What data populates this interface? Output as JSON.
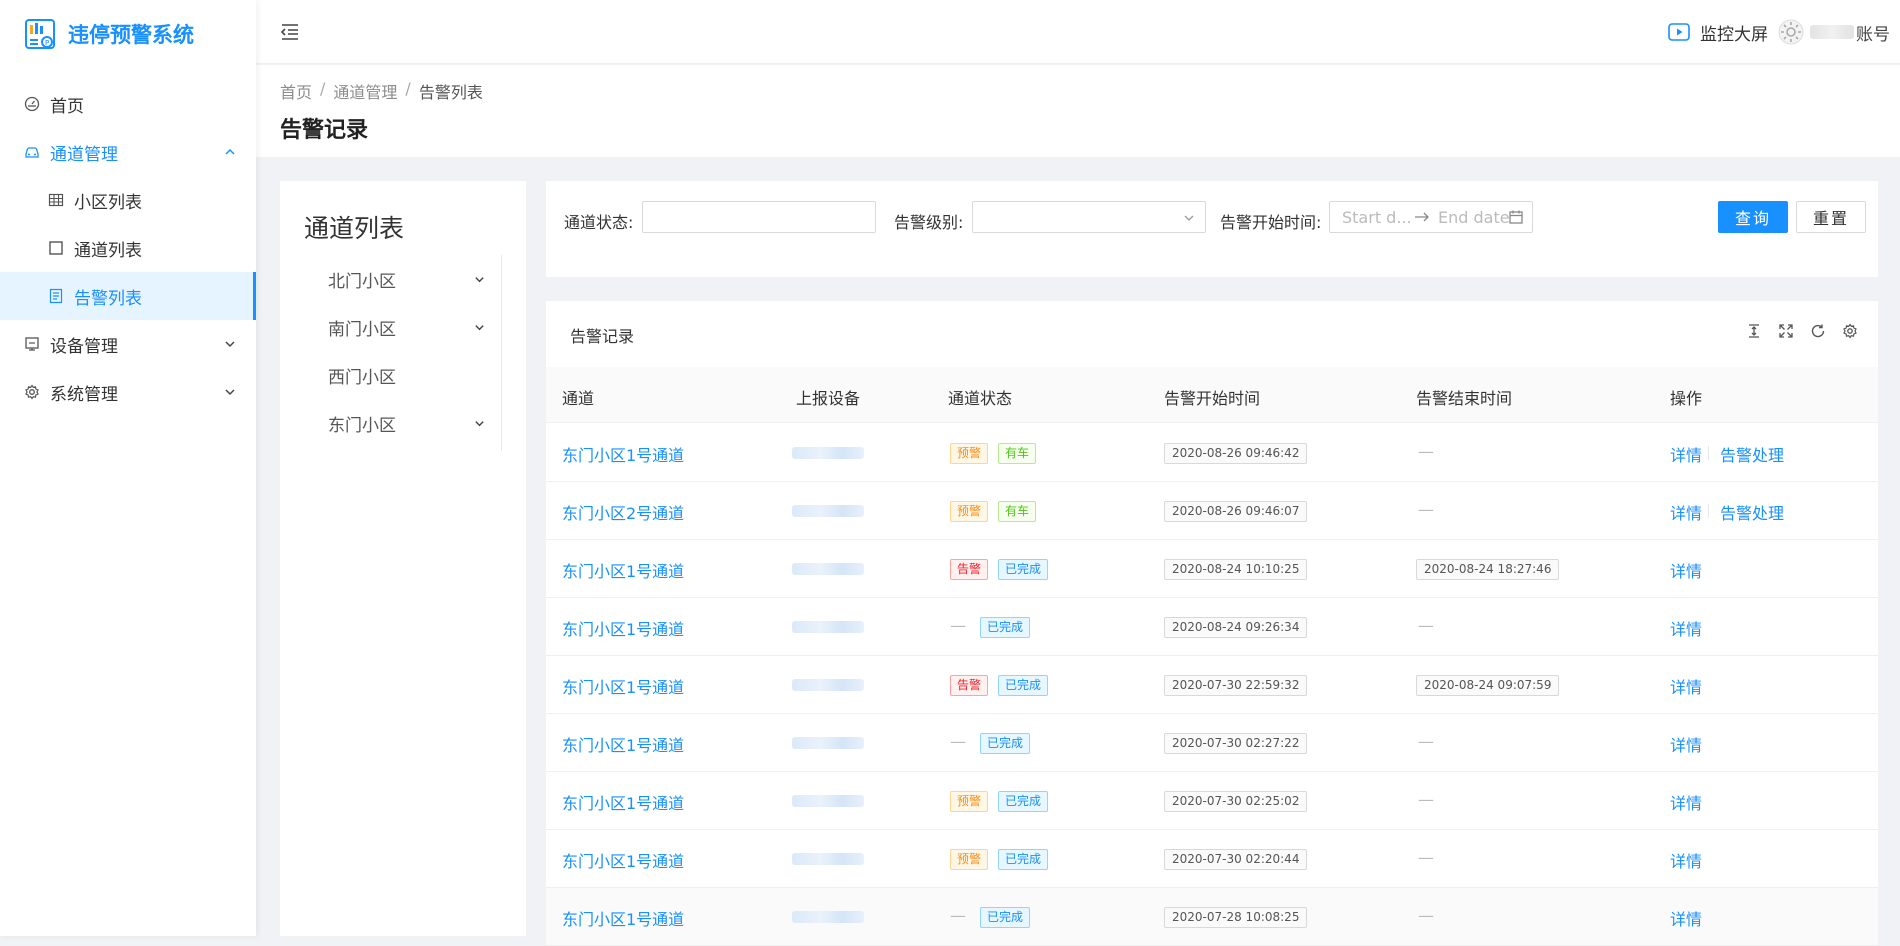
{
  "app": {
    "title": "违停预警系统"
  },
  "sidebar": {
    "items": [
      {
        "label": "首页",
        "icon": "dashboard-icon"
      },
      {
        "label": "通道管理",
        "icon": "car-icon",
        "expanded": true
      },
      {
        "label": "小区列表",
        "icon": "table-icon"
      },
      {
        "label": "通道列表",
        "icon": "square-icon"
      },
      {
        "label": "告警列表",
        "icon": "list-icon",
        "active": true
      },
      {
        "label": "设备管理",
        "icon": "device-icon"
      },
      {
        "label": "系统管理",
        "icon": "gear-icon"
      }
    ]
  },
  "header": {
    "monitor_label": "监控大屏",
    "account_suffix": "账号"
  },
  "breadcrumb": [
    "首页",
    "通道管理",
    "告警列表"
  ],
  "page_title": "告警记录",
  "tree": {
    "title": "通道列表",
    "items": [
      {
        "label": "北门小区",
        "expandable": true
      },
      {
        "label": "南门小区",
        "expandable": true
      },
      {
        "label": "西门小区",
        "expandable": false
      },
      {
        "label": "东门小区",
        "expandable": true
      }
    ]
  },
  "filters": {
    "status_label": "通道状态:",
    "status_value": "",
    "level_label": "告警级别:",
    "level_value": "",
    "time_label": "告警开始时间:",
    "start_placeholder": "Start d...",
    "end_placeholder": "End date",
    "query_button": "查询",
    "reset_button": "重置"
  },
  "table": {
    "title": "告警记录",
    "columns": [
      "通道",
      "上报设备",
      "通道状态",
      "告警开始时间",
      "告警结束时间",
      "操作"
    ],
    "rows": [
      {
        "channel": "东门小区1号通道",
        "level": "预警",
        "level_color": "orange",
        "state": "有车",
        "state_color": "green",
        "start": "2020-08-26 09:46:42",
        "end": "",
        "ops": [
          "详情",
          "告警处理"
        ]
      },
      {
        "channel": "东门小区2号通道",
        "level": "预警",
        "level_color": "orange",
        "state": "有车",
        "state_color": "green",
        "start": "2020-08-26 09:46:07",
        "end": "",
        "ops": [
          "详情",
          "告警处理"
        ]
      },
      {
        "channel": "东门小区1号通道",
        "level": "告警",
        "level_color": "red",
        "state": "已完成",
        "state_color": "blue",
        "start": "2020-08-24 10:10:25",
        "end": "2020-08-24 18:27:46",
        "ops": [
          "详情"
        ]
      },
      {
        "channel": "东门小区1号通道",
        "level": "",
        "level_color": "",
        "state": "已完成",
        "state_color": "blue",
        "start": "2020-08-24 09:26:34",
        "end": "",
        "ops": [
          "详情"
        ]
      },
      {
        "channel": "东门小区1号通道",
        "level": "告警",
        "level_color": "red",
        "state": "已完成",
        "state_color": "blue",
        "start": "2020-07-30 22:59:32",
        "end": "2020-08-24 09:07:59",
        "ops": [
          "详情"
        ]
      },
      {
        "channel": "东门小区1号通道",
        "level": "",
        "level_color": "",
        "state": "已完成",
        "state_color": "blue",
        "start": "2020-07-30 02:27:22",
        "end": "",
        "ops": [
          "详情"
        ]
      },
      {
        "channel": "东门小区1号通道",
        "level": "预警",
        "level_color": "orange",
        "state": "已完成",
        "state_color": "blue",
        "start": "2020-07-30 02:25:02",
        "end": "",
        "ops": [
          "详情"
        ]
      },
      {
        "channel": "东门小区1号通道",
        "level": "预警",
        "level_color": "orange",
        "state": "已完成",
        "state_color": "blue",
        "start": "2020-07-30 02:20:44",
        "end": "",
        "ops": [
          "详情"
        ]
      },
      {
        "channel": "东门小区1号通道",
        "level": "",
        "level_color": "",
        "state": "已完成",
        "state_color": "blue",
        "start": "2020-07-28 10:08:25",
        "end": "",
        "ops": [
          "详情"
        ]
      }
    ]
  },
  "colors": {
    "primary": "#1890ff",
    "warning": "#fa8c16",
    "success": "#52c41a",
    "danger": "#f5222d"
  }
}
